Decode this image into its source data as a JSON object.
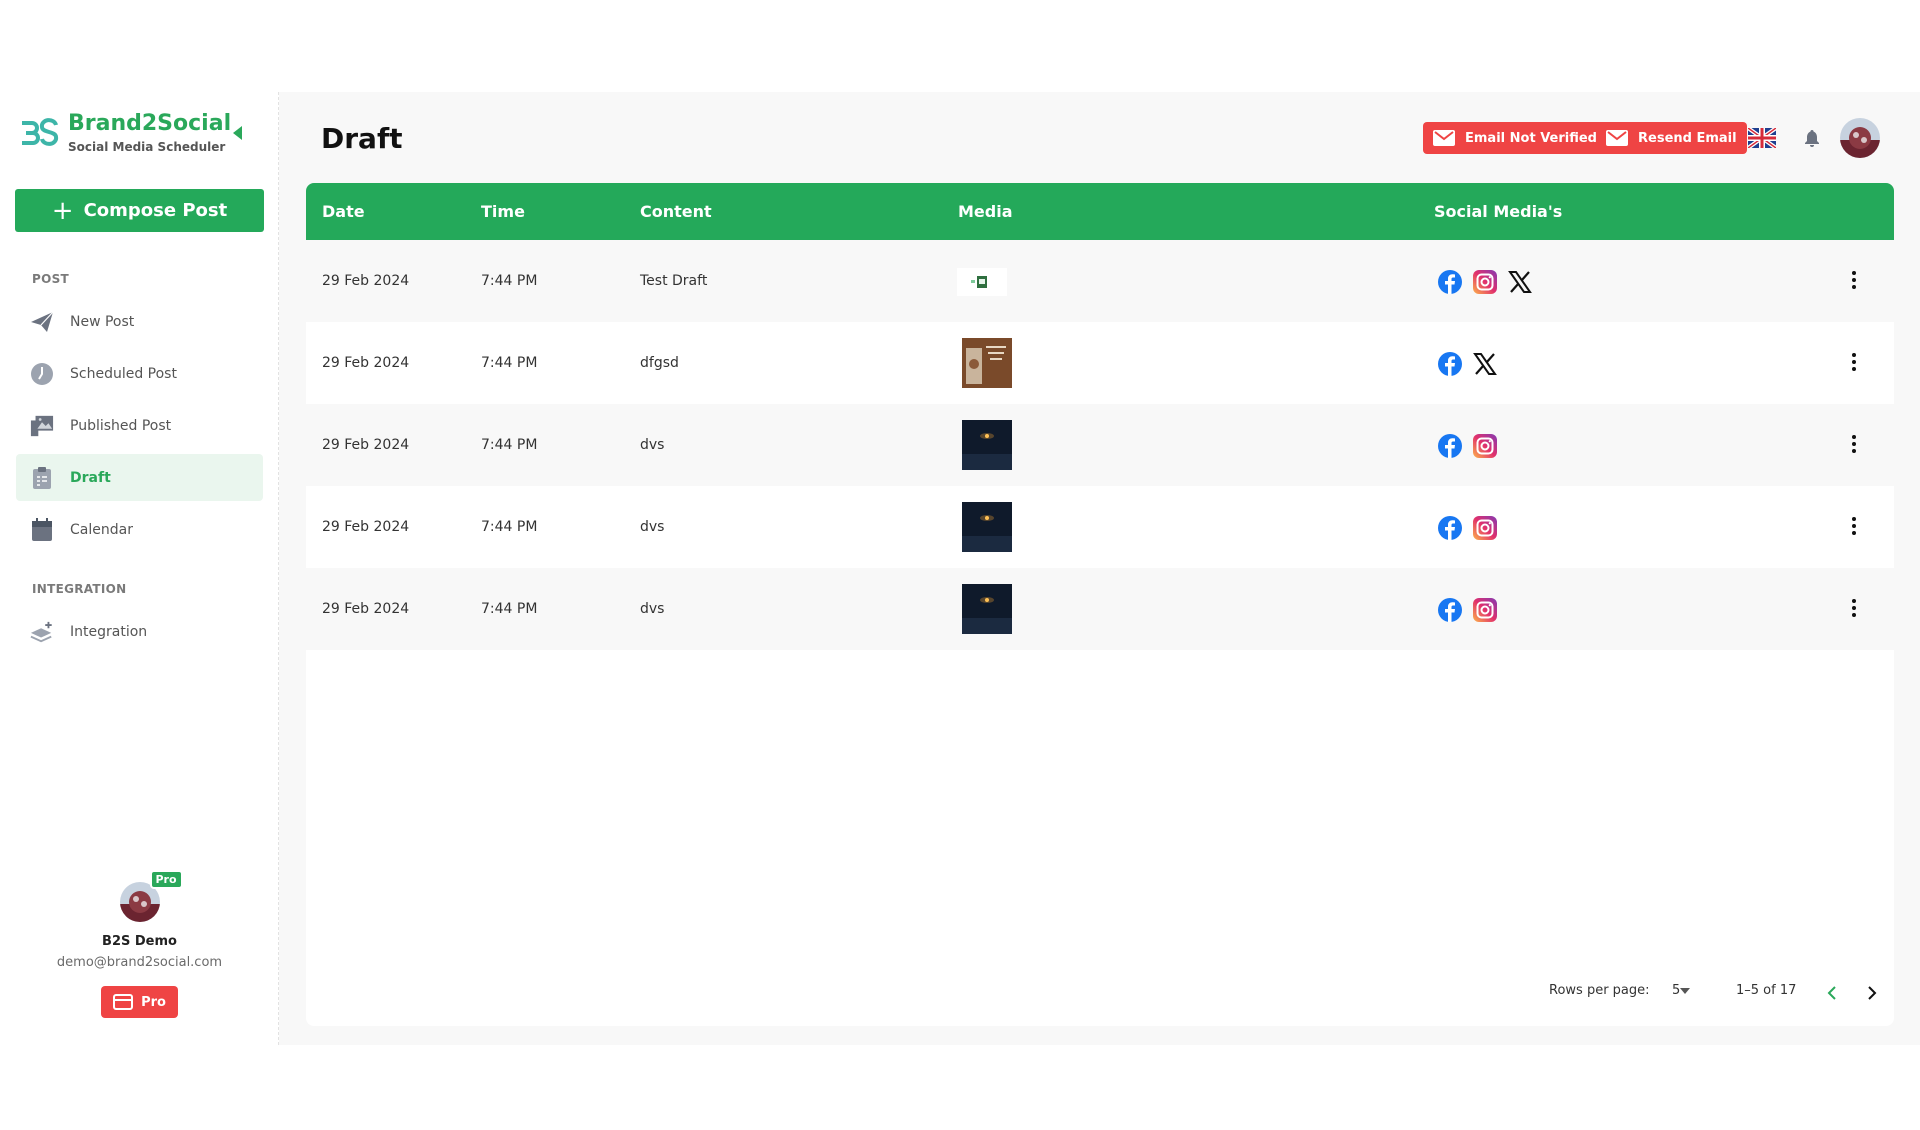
{
  "sidebar": {
    "brand_title": "Brand2Social",
    "brand_subtitle": "Social Media Scheduler",
    "compose_label": "Compose Post",
    "post_section": "POST",
    "integration_section": "INTEGRATION",
    "items": [
      {
        "label": "New Post",
        "icon": "paper-plane-icon"
      },
      {
        "label": "Scheduled Post",
        "icon": "clock-icon"
      },
      {
        "label": "Published Post",
        "icon": "gallery-icon"
      },
      {
        "label": "Draft",
        "icon": "clipboard-icon",
        "active": true
      },
      {
        "label": "Calendar",
        "icon": "calendar-icon"
      }
    ],
    "integration_items": [
      {
        "label": "Integration",
        "icon": "layers-plus-icon"
      }
    ],
    "profile": {
      "name": "B2S Demo",
      "email": "demo@brand2social.com",
      "badge": "Pro",
      "plan_button": "Pro"
    }
  },
  "header": {
    "title": "Draft",
    "email_not_verified": "Email Not Verified",
    "resend_email": "Resend Email"
  },
  "table": {
    "columns": [
      "Date",
      "Time",
      "Content",
      "Media",
      "Social Media's"
    ],
    "rows": [
      {
        "date": "29 Feb 2024",
        "time": "7:44 PM",
        "content": "Test Draft",
        "media": "logo-thumbnail",
        "socials": [
          "facebook",
          "instagram",
          "x"
        ]
      },
      {
        "date": "29 Feb 2024",
        "time": "7:44 PM",
        "content": "dfgsd",
        "media": "brown-poster-thumbnail",
        "socials": [
          "facebook",
          "x"
        ]
      },
      {
        "date": "29 Feb 2024",
        "time": "7:44 PM",
        "content": "dvs",
        "media": "night-sky-thumbnail",
        "socials": [
          "facebook",
          "instagram"
        ]
      },
      {
        "date": "29 Feb 2024",
        "time": "7:44 PM",
        "content": "dvs",
        "media": "night-sky-thumbnail",
        "socials": [
          "facebook",
          "instagram"
        ]
      },
      {
        "date": "29 Feb 2024",
        "time": "7:44 PM",
        "content": "dvs",
        "media": "night-sky-thumbnail",
        "socials": [
          "facebook",
          "instagram"
        ]
      }
    ]
  },
  "pagination": {
    "rows_per_page_label": "Rows per page:",
    "rows_per_page_value": "5",
    "range": "1–5 of 17"
  },
  "colors": {
    "brand_green": "#24a95a",
    "alert_red": "#ef4444",
    "facebook": "#1877f2"
  }
}
